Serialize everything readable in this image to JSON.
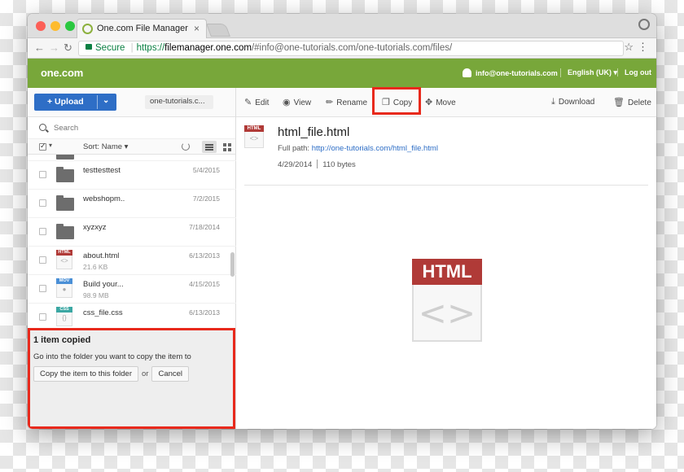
{
  "browser": {
    "tab_title": "One.com File Manager",
    "tab_close": "×",
    "url_secure": "Secure",
    "url_scheme": "https://",
    "url_host": "filemanager.one.com",
    "url_path": "/#info@one-tutorials.com/one-tutorials.com/files/"
  },
  "header": {
    "logo": "one.com",
    "user": "info@one-tutorials.com",
    "language": "English (UK) ▾",
    "logout": "Log out"
  },
  "sidebar": {
    "upload_label": "+ Upload",
    "upload_chevron": "⌄",
    "domain": "one-tutorials.c...",
    "search_placeholder": "Search",
    "sort_label": "Sort: Name ▾",
    "files": [
      {
        "name": "testtesttest",
        "date": "5/4/2015",
        "type": "folder"
      },
      {
        "name": "webshopm..",
        "date": "7/2/2015",
        "type": "folder"
      },
      {
        "name": "xyzxyz",
        "date": "7/18/2014",
        "type": "folder"
      },
      {
        "name": "about.html",
        "date": "6/13/2013",
        "size": "21.6 KB",
        "type": "html",
        "tag": "HTML"
      },
      {
        "name": "Build your...",
        "date": "4/15/2015",
        "size": "98.9 MB",
        "type": "mov",
        "tag": "MOV"
      },
      {
        "name": "css_file.css",
        "date": "6/13/2013",
        "size": "",
        "type": "css",
        "tag": "CSS"
      }
    ]
  },
  "notice": {
    "title": "1 item copied",
    "message": "Go into the folder you want to copy the item to",
    "copy_button": "Copy the item to this folder",
    "or": "or",
    "cancel_button": "Cancel"
  },
  "toolbar": {
    "edit": "Edit",
    "view": "View",
    "rename": "Rename",
    "copy": "Copy",
    "move": "Move",
    "download": "Download",
    "delete": "Delete"
  },
  "file_info": {
    "title": "html_file.html",
    "path_label": "Full path:",
    "path_url": "http://one-tutorials.com/html_file.html",
    "date": "4/29/2014",
    "size": "110 bytes",
    "icon_tag": "HTML",
    "icon_glyph": "<>"
  }
}
